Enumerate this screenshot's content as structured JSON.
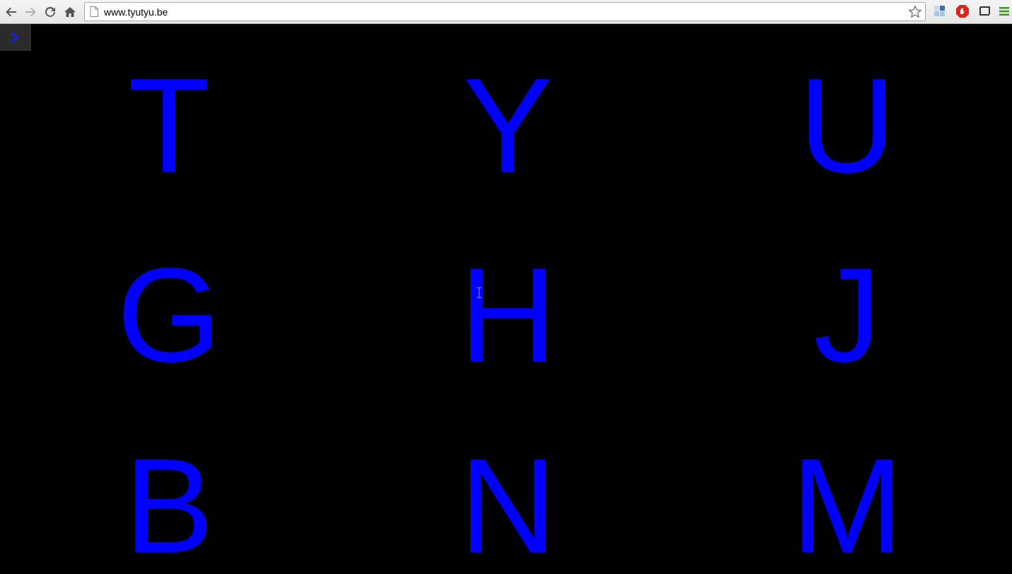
{
  "browser": {
    "url": "www.tyutyu.be",
    "icons": {
      "back": "back-arrow-icon",
      "forward": "forward-arrow-icon",
      "reload": "reload-icon",
      "home": "home-icon",
      "bookmark": "star-icon",
      "extensions": [
        "apps-grid-icon",
        "adblock-hand-icon",
        "cast-icon"
      ],
      "menu": "hamburger-menu-icon"
    }
  },
  "page": {
    "menu_toggle_icon": "chevron-right-icon",
    "accent_color": "#0000ff",
    "background_color": "#000000",
    "keys": [
      [
        "T",
        "Y",
        "U"
      ],
      [
        "G",
        "H",
        "J"
      ],
      [
        "B",
        "N",
        "M"
      ]
    ]
  }
}
